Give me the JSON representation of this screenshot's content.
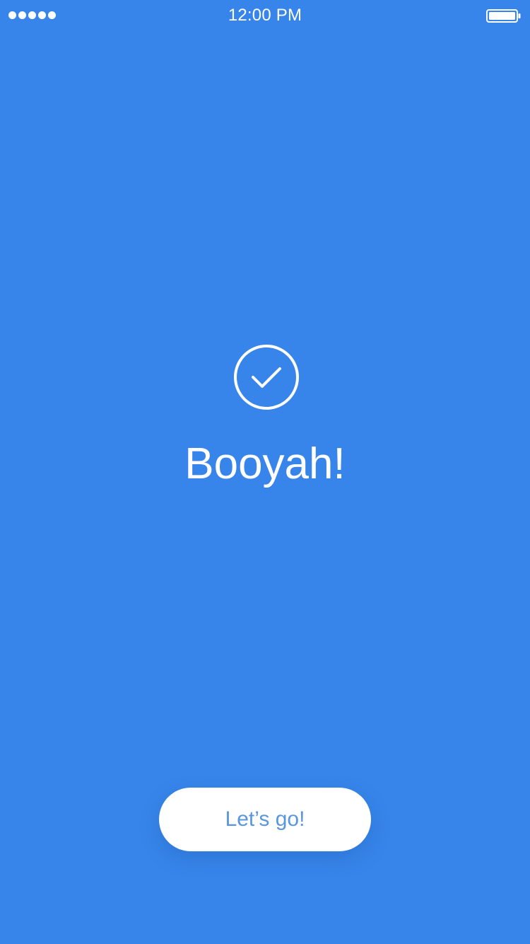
{
  "status_bar": {
    "time": "12:00 PM",
    "signal_dots": 5,
    "signal_icon": "signal-dots-icon",
    "battery_icon": "battery-icon"
  },
  "main": {
    "success_icon": "checkmark-circle-icon",
    "headline": "Booyah!",
    "button_label": "Let’s go!"
  },
  "colors": {
    "background": "#3785ea",
    "foreground": "#ffffff",
    "button_text": "#5a96df"
  }
}
